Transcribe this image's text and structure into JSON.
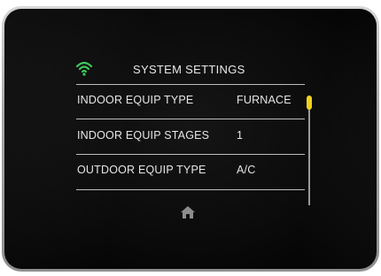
{
  "header": {
    "title": "SYSTEM SETTINGS",
    "wifi_icon": "wifi-icon",
    "wifi_color": "#3cc85a"
  },
  "settings": [
    {
      "label": "INDOOR EQUIP TYPE",
      "value": "FURNACE"
    },
    {
      "label": "INDOOR EQUIP STAGES",
      "value": "1"
    },
    {
      "label": "OUTDOOR EQUIP TYPE",
      "value": "A/C"
    }
  ],
  "scrollbar": {
    "thumb_color": "#f2d11a",
    "position_fraction": 0.0
  },
  "footer": {
    "home_icon": "home-icon"
  }
}
